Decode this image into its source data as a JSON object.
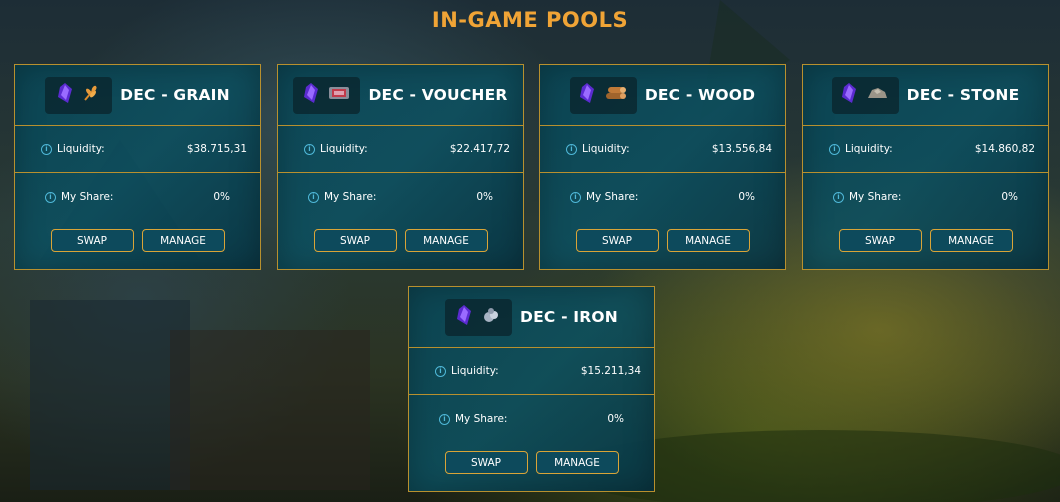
{
  "page": {
    "title": "IN-GAME POOLS"
  },
  "labels": {
    "liquidity": "Liquidity:",
    "my_share": "My Share:",
    "swap": "SWAP",
    "manage": "MANAGE",
    "info_glyph": "i"
  },
  "pools": [
    {
      "name": "DEC - GRAIN",
      "liquidity": "$38.715,31",
      "share": "0%",
      "resource_icon": "grain-icon"
    },
    {
      "name": "DEC - VOUCHER",
      "liquidity": "$22.417,72",
      "share": "0%",
      "resource_icon": "voucher-icon"
    },
    {
      "name": "DEC - WOOD",
      "liquidity": "$13.556,84",
      "share": "0%",
      "resource_icon": "wood-icon"
    },
    {
      "name": "DEC - STONE",
      "liquidity": "$14.860,82",
      "share": "0%",
      "resource_icon": "stone-icon"
    },
    {
      "name": "DEC - IRON",
      "liquidity": "$15.211,34",
      "share": "0%",
      "resource_icon": "iron-icon"
    }
  ],
  "colors": {
    "accent": "#f0a436",
    "border": "#b8902e",
    "card": "#0c5060",
    "info": "#4fb8d8"
  }
}
